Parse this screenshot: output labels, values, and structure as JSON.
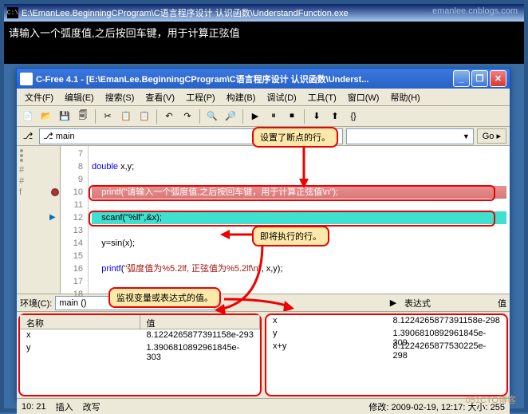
{
  "watermarks": {
    "top": "emanlee.cnblogs.com",
    "bottom": "051CTO博客"
  },
  "console": {
    "icon_label": "C:\\",
    "title": "E:\\EmanLee.BeginningCProgram\\C语言程序设计 认识函数\\UnderstandFunction.exe",
    "output": "请输入一个弧度值,之后按回车键，用于计算正弦值"
  },
  "ide": {
    "title": "C-Free 4.1 - [E:\\EmanLee.BeginningCProgram\\C语言程序设计 认识函数\\Underst...",
    "menubar": [
      "文件(F)",
      "编辑(E)",
      "搜索(S)",
      "查看(V)",
      "工程(P)",
      "构建(B)",
      "调试(D)",
      "工具(T)",
      "窗口(W)",
      "帮助(H)"
    ],
    "toolbar_icons": [
      "📄",
      "📂",
      "💾",
      "🗐",
      "|",
      "✂",
      "📋",
      "📋",
      "|",
      "↶",
      "↷",
      "|",
      "🔍",
      "🔎",
      "|",
      "▶",
      "⏸",
      "⏹",
      "|",
      "⬇",
      "⬆",
      "{}"
    ],
    "scope": {
      "symbol_icon": "⎇",
      "func": "⎇ main",
      "go": "Go ▸"
    },
    "code": {
      "lines": [
        {
          "n": 7,
          "txt": ""
        },
        {
          "n": 8,
          "txt": "    double x,y;",
          "parts": [
            [
              "kw",
              "double"
            ],
            [
              "",
              " x,y;"
            ]
          ]
        },
        {
          "n": 9,
          "txt": ""
        },
        {
          "n": 10,
          "bp": true,
          "txt": "    printf(\"请输入一个弧度值,之后按回车键，用于计算正弦值\\n\");"
        },
        {
          "n": 11,
          "txt": ""
        },
        {
          "n": 12,
          "cur": true,
          "txt": "    scanf(\"%lf\",&x);"
        },
        {
          "n": 13,
          "txt": ""
        },
        {
          "n": 14,
          "txt": "    y=sin(x);"
        },
        {
          "n": 15,
          "txt": ""
        },
        {
          "n": 16,
          "txt": "    printf(\"弧度值为%5.2lf, 正弦值为%5.2lf\\n\", x,y);",
          "parts": [
            [
              "",
              "    "
            ],
            [
              "kw",
              "printf"
            ],
            [
              "",
              "("
            ],
            [
              "str",
              "\"弧度值为%5.2lf, 正弦值为%5.2lf\\n\""
            ],
            [
              "",
              ", x,y);"
            ]
          ]
        },
        {
          "n": 17,
          "txt": ""
        },
        {
          "n": 18,
          "txt": ""
        }
      ]
    },
    "annotations": {
      "bp_line": "设置了断点的行。",
      "cur_line": "即将执行的行。",
      "watch": "监视变量或表达式的值。"
    },
    "bottom": {
      "env_label": "环境(C):",
      "env_value": "main ()",
      "expr_tab": "表达式",
      "value_tab": "值",
      "local_name": "名称",
      "local_value": "值",
      "locals": [
        {
          "name": "x",
          "val": "8.1224265877391158e-293"
        },
        {
          "name": "y",
          "val": "1.3906810892961845e-303"
        }
      ],
      "exprs": [
        {
          "name": "x",
          "val": "8.1224265877391158e-298"
        },
        {
          "name": "y",
          "val": "1.3906810892961845e-309"
        },
        {
          "name": "x+y",
          "val": "8.1224265877530225e-298"
        }
      ]
    },
    "status": {
      "left": [
        "10: 21",
        "插入",
        "改写"
      ],
      "right": "修改: 2009-02-19, 12:17:  大小:  255"
    }
  }
}
